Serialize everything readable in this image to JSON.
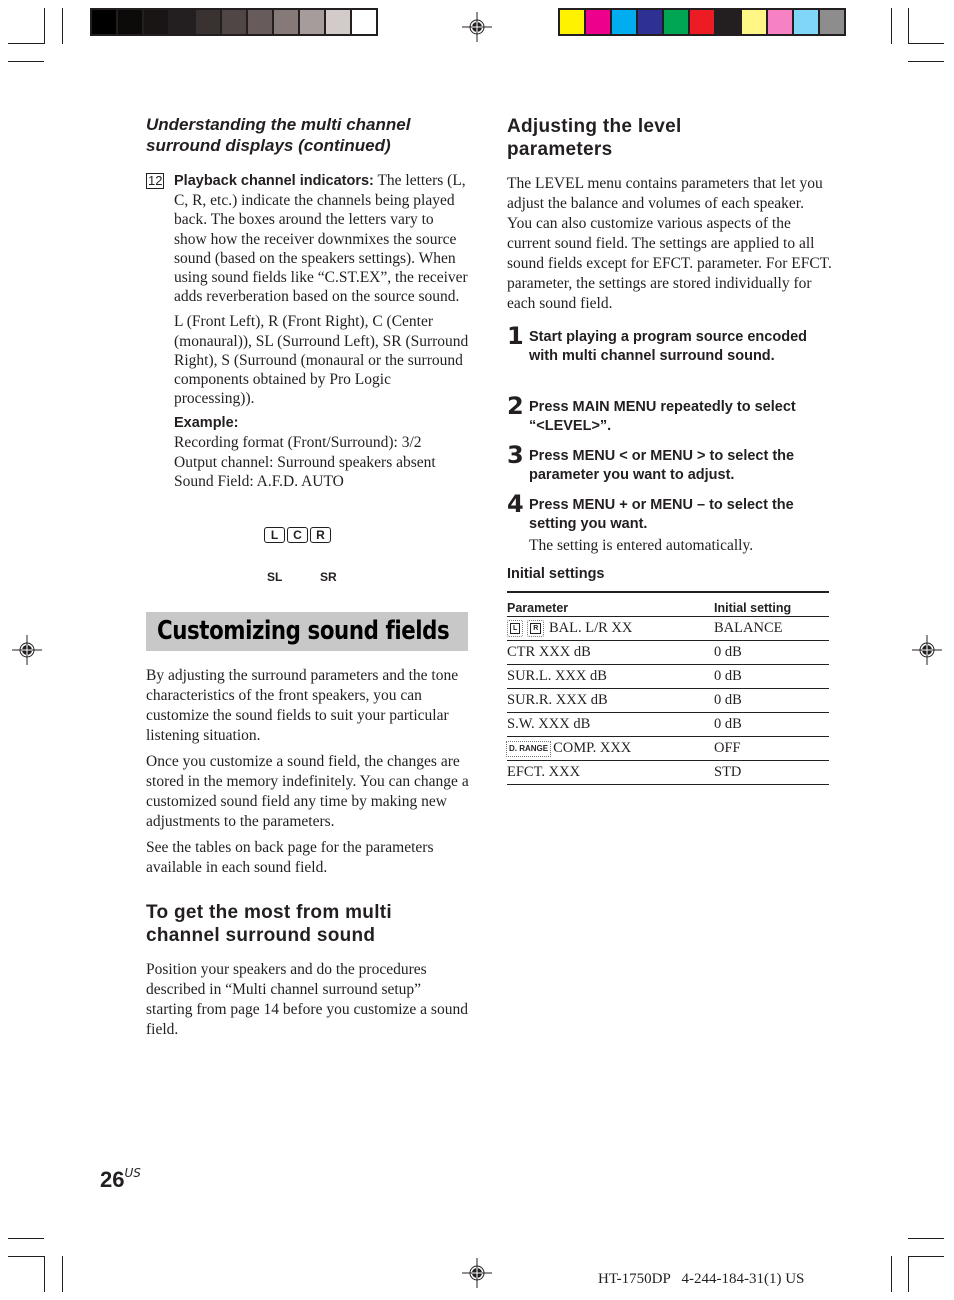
{
  "print_marks": {
    "grayscale_swatches": [
      "#000000",
      "#0d0b0a",
      "#181514",
      "#231f20",
      "#3a3230",
      "#4f4645",
      "#675c5b",
      "#867a78",
      "#a69c9b",
      "#d2cbca",
      "#ffffff"
    ],
    "color_swatches": [
      "#fff200",
      "#ec008c",
      "#00aeef",
      "#2e3192",
      "#00a651",
      "#ed1c24",
      "#231f20",
      "#fff685",
      "#f682c3",
      "#7fd6f7",
      "#8d8d8d"
    ]
  },
  "left_column": {
    "running_head": "Understanding the multi channel surround displays (continued)",
    "item": {
      "number": "12",
      "label": "Playback channel indicators:",
      "text": " The letters (L, C, R, etc.) indicate the channels being played back. The boxes around the letters vary to show how the receiver downmixes the source sound (based on the speakers settings). When using sound fields like “C.ST.EX”, the receiver adds reverberation based on the source sound.",
      "legend": "L (Front Left), R (Front Right), C (Center (monaural)), SL (Surround Left), SR (Surround Right), S (Surround (monaural or the surround components obtained by Pro Logic processing)).",
      "example_label": "Example:",
      "example_lines": [
        "Recording format (Front/Surround): 3/2",
        "Output channel: Surround speakers absent",
        "Sound Field: A.F.D. AUTO"
      ],
      "channel_display": {
        "front": [
          "L",
          "C",
          "R"
        ],
        "surround": [
          "SL",
          "SR"
        ]
      }
    },
    "section_banner": "Customizing sound fields",
    "intro_paragraphs": [
      "By adjusting the surround parameters and the tone characteristics of the front speakers, you can customize the sound fields to suit your particular listening situation.",
      "Once you customize a sound field, the changes are stored in the memory indefinitely. You can change a customized sound field any time by making new adjustments to the parameters.",
      "See the tables on back page for the parameters available in each sound field."
    ],
    "subsection": {
      "heading": "To get the most from multi channel surround sound",
      "text": "Position your speakers and do the procedures described in “Multi channel surround setup” starting from page 14 before you customize a sound field."
    }
  },
  "right_column": {
    "heading": "Adjusting the level parameters",
    "intro": "The LEVEL menu contains parameters that let you adjust the balance and volumes of each speaker. You can also customize various aspects of the current sound field. The settings are applied to all sound fields except for EFCT. parameter. For EFCT. parameter, the settings are stored individually for each sound field.",
    "steps": [
      {
        "num": "1",
        "text": "Start playing a program source encoded with multi channel surround sound.",
        "note": ""
      },
      {
        "num": "2",
        "text": "Press MAIN MENU repeatedly to select “<LEVEL>”.",
        "note": ""
      },
      {
        "num": "3",
        "text": "Press MENU < or MENU > to select the parameter you want to adjust.",
        "note": ""
      },
      {
        "num": "4",
        "text": "Press MENU + or MENU – to select the setting you want.",
        "note": "The setting is entered automatically."
      }
    ],
    "table": {
      "title": "Initial settings",
      "headers": [
        "Parameter",
        "Initial setting"
      ],
      "rows": [
        {
          "icons": [
            "L",
            "R"
          ],
          "parameter": "BAL. L/R XX",
          "setting": "BALANCE"
        },
        {
          "icons": [],
          "parameter": "CTR XXX dB",
          "setting": "0 dB"
        },
        {
          "icons": [],
          "parameter": "SUR.L. XXX dB",
          "setting": "0 dB"
        },
        {
          "icons": [],
          "parameter": "SUR.R. XXX dB",
          "setting": "0 dB"
        },
        {
          "icons": [],
          "parameter": "S.W. XXX dB",
          "setting": "0 dB"
        },
        {
          "icons": [
            "D. RANGE"
          ],
          "parameter": "COMP. XXX",
          "setting": "OFF"
        },
        {
          "icons": [],
          "parameter": "EFCT. XXX",
          "setting": "STD"
        }
      ]
    }
  },
  "footer": {
    "page_number": "26",
    "page_suffix": "US",
    "model_code": "HT-1750DP   4-244-184-31(1) US"
  }
}
